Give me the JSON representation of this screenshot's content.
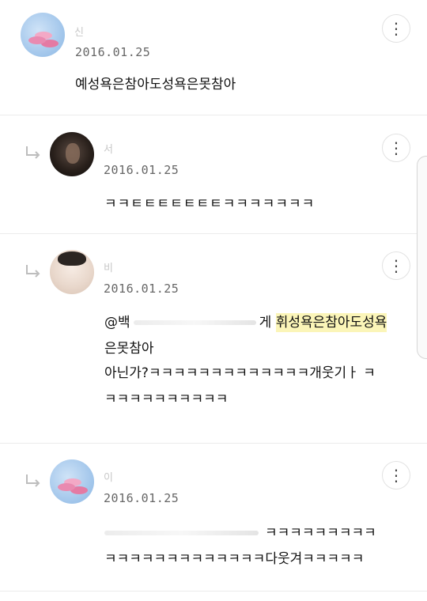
{
  "comments": [
    {
      "author": "신",
      "date": "2016.01.25",
      "is_reply": false,
      "text": "예성욕은참아도성욕은못참아",
      "menu_icon": "⋮"
    },
    {
      "author": "서",
      "date": "2016.01.25",
      "is_reply": true,
      "text": "ㅋㅋㅌㅌㅌㅌㅌㅌㅌㅋㅋㅋㅋㅋㅋㅋ",
      "menu_icon": "⋮"
    },
    {
      "author": "비",
      "date": "2016.01.25",
      "is_reply": true,
      "mention": "@백",
      "text_suffix": "게",
      "highlight": "휘성욕은참아도성욕",
      "line2": "은못참아",
      "line3": "아닌가?ㅋㅋㅋㅋㅋㅋㅋㅋㅋㅋㅋㅋㅋ개웃기ㅏ ㅋ",
      "line4": "ㅋㅋㅋㅋㅋㅋㅋㅋㅋㅋ",
      "menu_icon": "⋮"
    },
    {
      "author": "이",
      "date": "2016.01.25",
      "is_reply": true,
      "line1_visible": "ㅋㅋㅋㅋㅋㅋㅋㅋㅋ",
      "line2": "ㅋㅋㅋㅋㅋㅋㅋㅋㅋㅋㅋㅋㅋ다웃겨ㅋㅋㅋㅋㅋ",
      "menu_icon": "⋮"
    }
  ]
}
